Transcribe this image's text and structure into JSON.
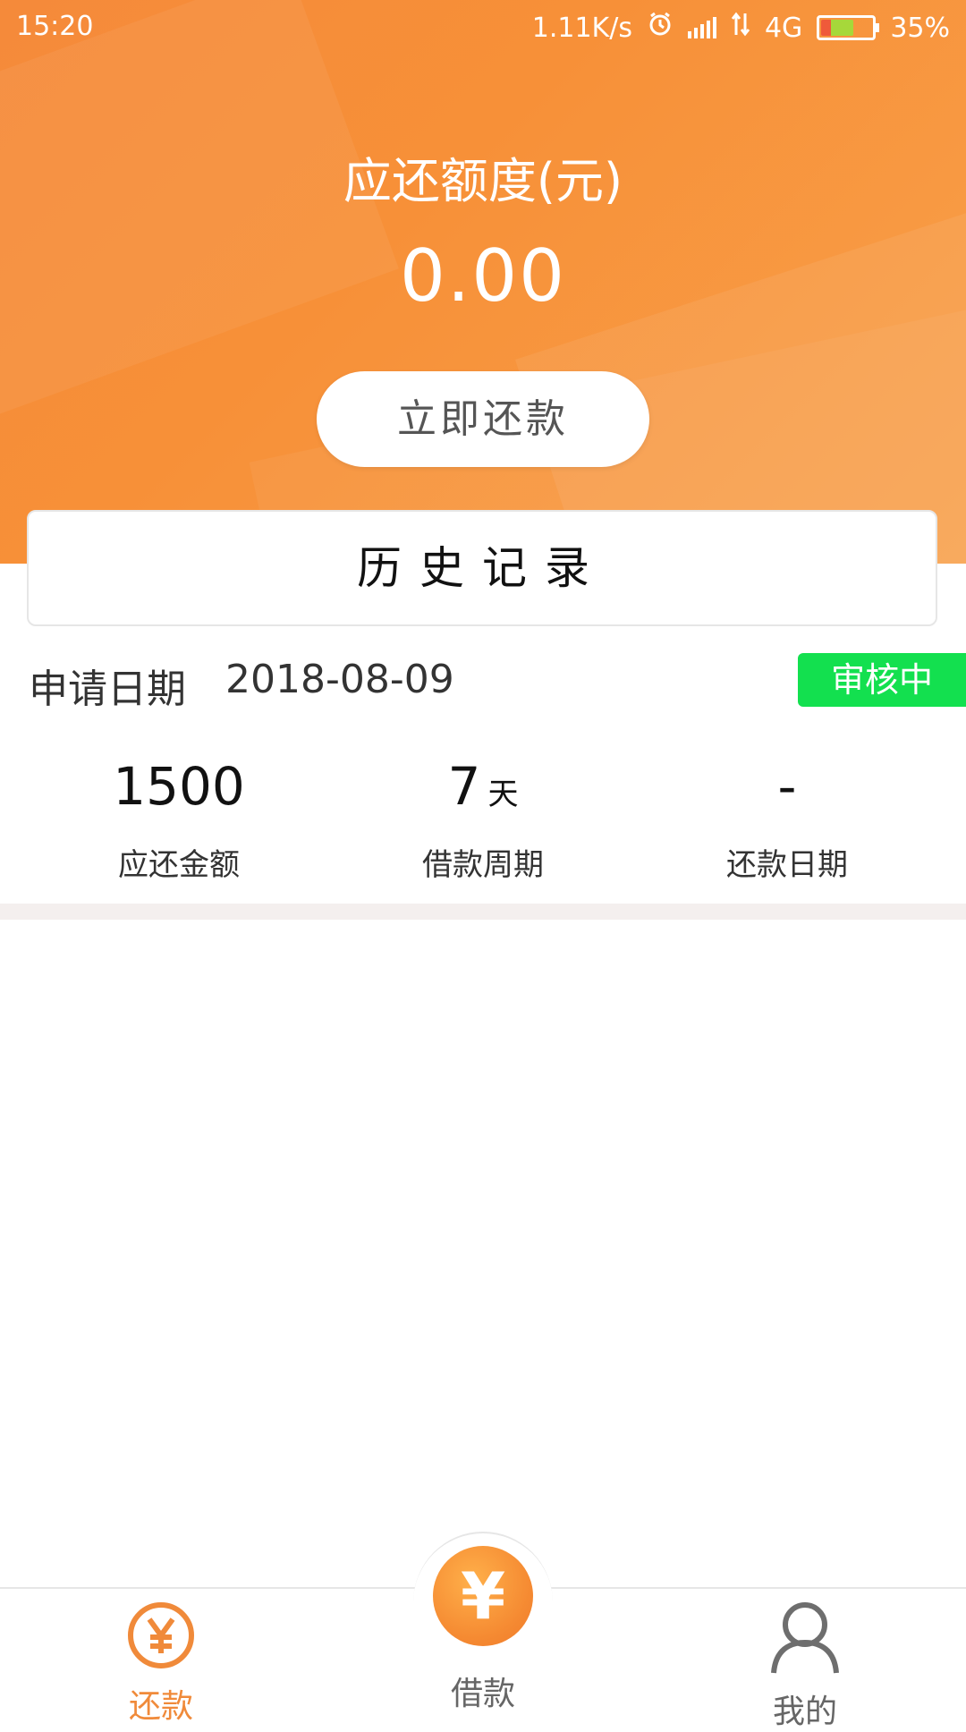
{
  "status_bar": {
    "time": "15:20",
    "network_speed": "1.11K/s",
    "network_type": "4G",
    "battery_percent": "35%",
    "icons": [
      "alarm-icon",
      "signal-icon",
      "data-icon",
      "battery-icon"
    ]
  },
  "header": {
    "title": "应还额度(元)",
    "amount": "0.00",
    "repay_button": "立即还款",
    "colors": {
      "accent": "#f79038",
      "badge": "#13e04f"
    }
  },
  "history": {
    "title": "历史记录",
    "apply_label": "申请日期",
    "apply_date": "2018-08-09",
    "status": "审核中",
    "stats": [
      {
        "value": "1500",
        "unit": "",
        "label": "应还金额"
      },
      {
        "value": "7",
        "unit": "天",
        "label": "借款周期"
      },
      {
        "value": "-",
        "unit": "",
        "label": "还款日期"
      }
    ]
  },
  "nav": {
    "left": {
      "label": "还款",
      "icon": "yen-circle-icon"
    },
    "center": {
      "label": "借款",
      "icon": "yen-icon"
    },
    "right": {
      "label": "我的",
      "icon": "user-icon"
    }
  }
}
